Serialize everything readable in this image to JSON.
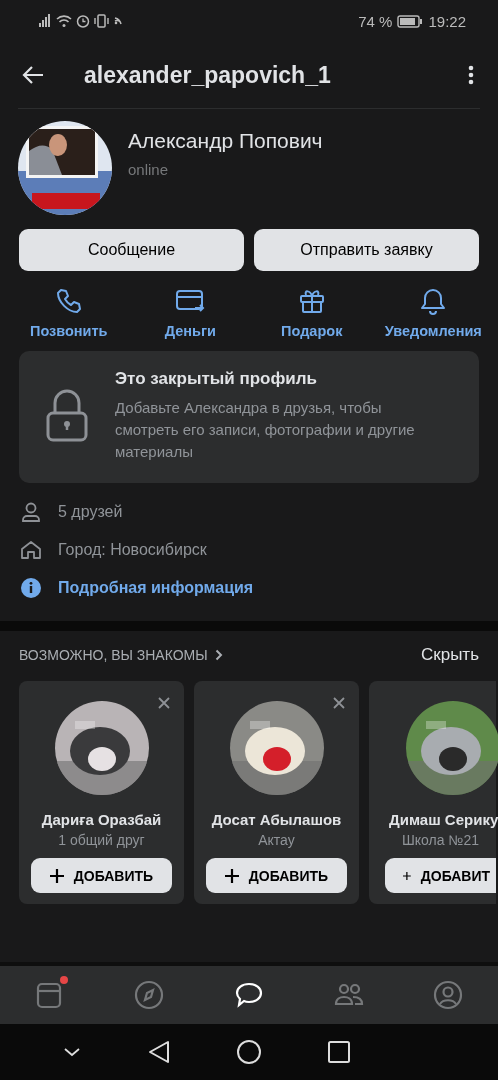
{
  "status_bar": {
    "battery": "74 %",
    "time": "19:22"
  },
  "header": {
    "title": "alexander_papovich_1"
  },
  "profile": {
    "name": "Александр Попович",
    "status": "online"
  },
  "buttons": [
    "Сообщение",
    "Отправить заявку"
  ],
  "actions": [
    {
      "kind": "call",
      "label": "Позвонить"
    },
    {
      "kind": "money",
      "label": "Деньги"
    },
    {
      "kind": "gift",
      "label": "Подарок"
    },
    {
      "kind": "bell",
      "label": "Уведомления"
    }
  ],
  "private_notice": {
    "title": "Это закрытый профиль",
    "text": "Добавьте Александра в друзья, чтобы смотреть его записи, фотографии и другие материалы"
  },
  "info": [
    {
      "kind": "friends",
      "text": "5 друзей"
    },
    {
      "kind": "city",
      "text": "Город: Новосибирск"
    },
    {
      "kind": "more",
      "text": "Подробная информация"
    }
  ],
  "suggestions": {
    "title": "ВОЗМОЖНО, ВЫ ЗНАКОМЫ",
    "hide": "Скрыть",
    "cards": [
      {
        "name": "Дариға Оразбай",
        "subtitle": "1 общий друг",
        "button": "ДОБАВИТЬ",
        "dismissable": true
      },
      {
        "name": "Досат Абылашов",
        "subtitle": "Актау",
        "button": "ДОБАВИТЬ",
        "dismissable": true
      },
      {
        "name": "Димаш Серику",
        "subtitle": "Школа №21",
        "button": "ДОБАВИТ",
        "dismissable": false
      }
    ]
  },
  "tab_bar": [
    {
      "kind": "news",
      "selected": false,
      "dot": true
    },
    {
      "kind": "explore",
      "selected": false,
      "dot": false
    },
    {
      "kind": "messages",
      "selected": true,
      "dot": false
    },
    {
      "kind": "friends",
      "selected": false,
      "dot": false
    },
    {
      "kind": "profile",
      "selected": false,
      "dot": false
    }
  ]
}
